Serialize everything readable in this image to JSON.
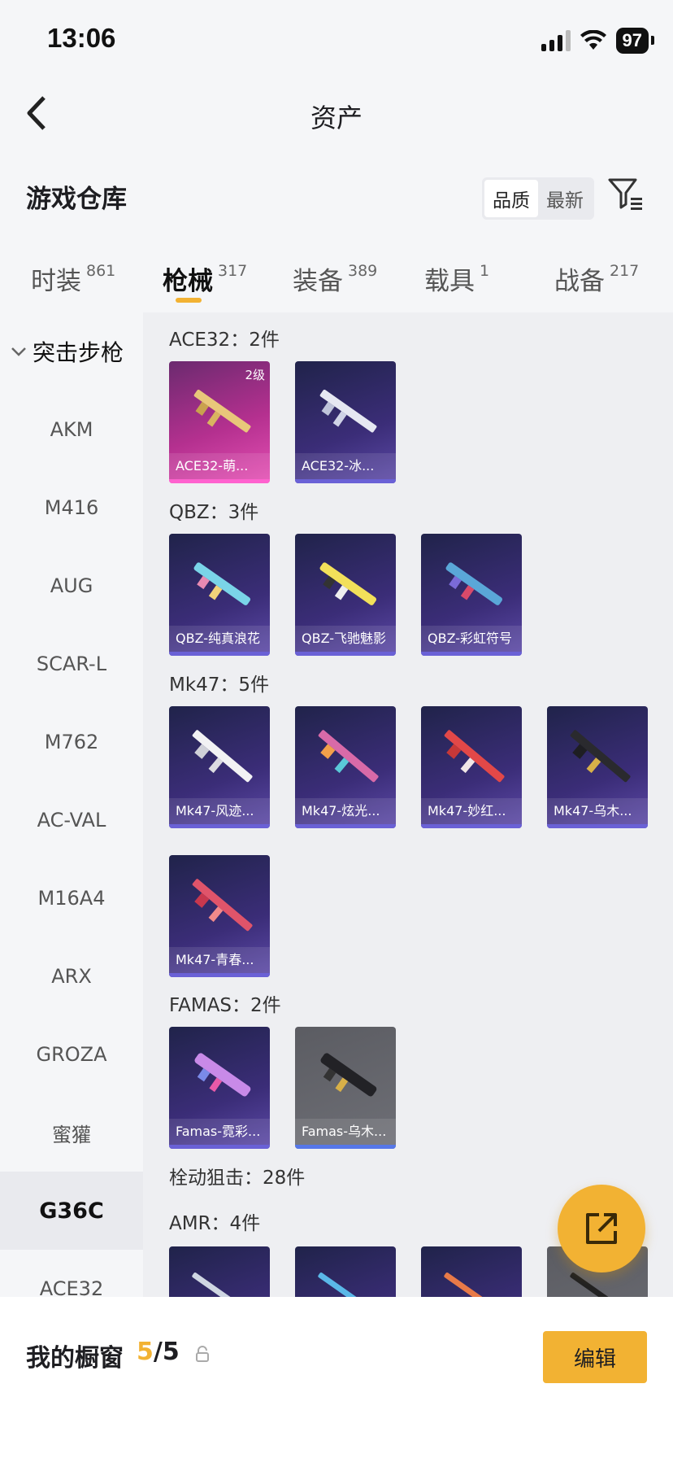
{
  "status": {
    "time": "13:06",
    "battery": "97"
  },
  "nav": {
    "title": "资产"
  },
  "section": {
    "title": "游戏仓库",
    "sort_quality": "品质",
    "sort_newest": "最新"
  },
  "tabs": [
    {
      "label": "时装",
      "count": "861"
    },
    {
      "label": "枪械",
      "count": "317"
    },
    {
      "label": "装备",
      "count": "389"
    },
    {
      "label": "载具",
      "count": "1"
    },
    {
      "label": "战备",
      "count": "217"
    }
  ],
  "sidebar": {
    "group": "突击步枪",
    "items": [
      "AKM",
      "M416",
      "AUG",
      "SCAR-L",
      "M762",
      "AC-VAL",
      "M16A4",
      "ARX",
      "GROZA",
      "蜜獾",
      "G36C",
      "ACE32"
    ],
    "active": "G36C"
  },
  "groups": [
    {
      "title": "ACE32：2件",
      "items": [
        {
          "label": "ACE32-萌...",
          "level": "2级"
        },
        {
          "label": "ACE32-冰..."
        }
      ]
    },
    {
      "title": "QBZ：3件",
      "items": [
        {
          "label": "QBZ-纯真浪花"
        },
        {
          "label": "QBZ-飞驰魅影"
        },
        {
          "label": "QBZ-彩虹符号"
        }
      ]
    },
    {
      "title": "Mk47：5件",
      "items": [
        {
          "label": "Mk47-风迹..."
        },
        {
          "label": "Mk47-炫光..."
        },
        {
          "label": "Mk47-妙红..."
        },
        {
          "label": "Mk47-乌木..."
        },
        {
          "label": "Mk47-青春..."
        }
      ]
    },
    {
      "title": "FAMAS：2件",
      "items": [
        {
          "label": "Famas-霓彩..."
        },
        {
          "label": "Famas-乌木..."
        }
      ]
    },
    {
      "title": "栓动狙击：28件"
    },
    {
      "title": "AMR：4件"
    }
  ],
  "bottom": {
    "label": "我的橱窗",
    "current": "5",
    "total": "/5",
    "edit": "编辑"
  },
  "colors": {
    "accent": "#f2b233",
    "card_purple": "#3b2d78",
    "card_pink": "#b4308f",
    "card_gray": "#6e6f76"
  }
}
